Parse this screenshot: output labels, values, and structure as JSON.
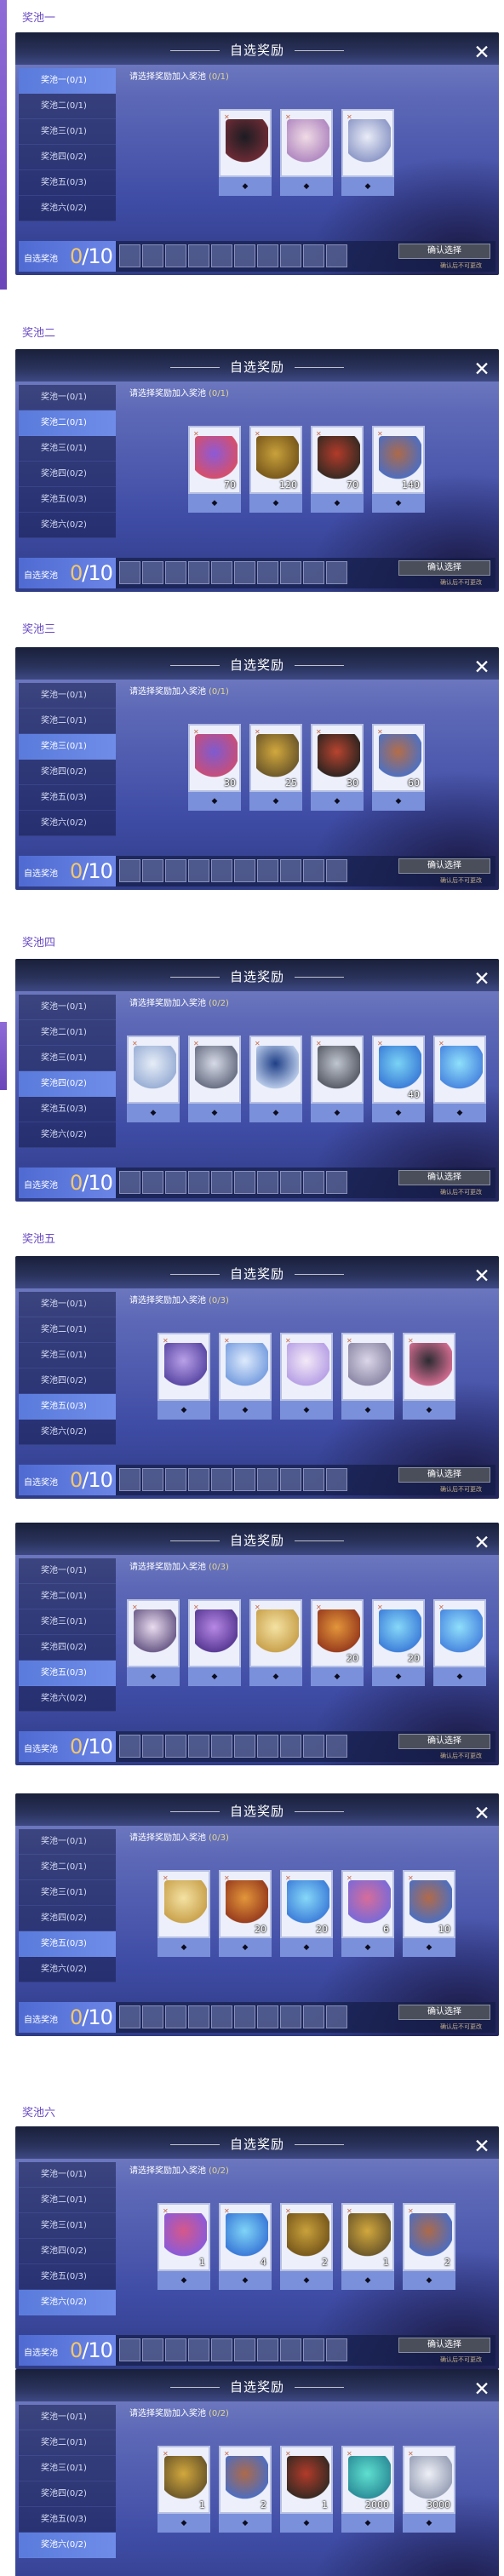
{
  "gutters": [
    1,
    2
  ],
  "screens": [
    {
      "section": "奖池一",
      "selected_tab": 0,
      "count": "0/1",
      "items": [
        {
          "icon": "armor-icon",
          "qty": "",
          "colors": [
            "#1c1c22",
            "#6b2b35"
          ]
        },
        {
          "icon": "dress-icon",
          "qty": "",
          "colors": [
            "#f0dbe5",
            "#b28ac1"
          ]
        },
        {
          "icon": "wing-weapon-icon",
          "qty": "",
          "colors": [
            "#e9ecf7",
            "#8f9ac8"
          ]
        }
      ]
    },
    {
      "section": "奖池二",
      "selected_tab": 1,
      "count": "0/1",
      "items": [
        {
          "icon": "gem-stone-icon",
          "qty": "70",
          "colors": [
            "#8c5ad7",
            "#d64f6b"
          ]
        },
        {
          "icon": "treasure-chest-icon",
          "qty": "120",
          "colors": [
            "#c9a13b",
            "#7a5a1c"
          ]
        },
        {
          "icon": "hammer-icon",
          "qty": "70",
          "colors": [
            "#b23b2a",
            "#3a2a22"
          ]
        },
        {
          "icon": "ore-icon",
          "qty": "140",
          "colors": [
            "#ad6a4a",
            "#4f6dbe"
          ]
        }
      ]
    },
    {
      "section": "奖池三",
      "selected_tab": 2,
      "count": "0/1",
      "items": [
        {
          "icon": "gem-stone-icon",
          "qty": "30",
          "colors": [
            "#7e5bd0",
            "#c74e7a"
          ]
        },
        {
          "icon": "crown-icon",
          "qty": "25",
          "colors": [
            "#d2a83d",
            "#6f5a2a"
          ]
        },
        {
          "icon": "hammer-icon",
          "qty": "30",
          "colors": [
            "#b8442f",
            "#322520"
          ]
        },
        {
          "icon": "ore-icon",
          "qty": "60",
          "colors": [
            "#b46d49",
            "#5070bf"
          ]
        }
      ]
    },
    {
      "section": "奖池四",
      "selected_tab": 3,
      "count": "0/2",
      "items": [
        {
          "icon": "gown-icon",
          "qty": "",
          "colors": [
            "#e6edf7",
            "#9bb0d6"
          ]
        },
        {
          "icon": "trident-icon",
          "qty": "",
          "colors": [
            "#d7dbe8",
            "#6b7185"
          ]
        },
        {
          "icon": "armor-icon",
          "qty": "",
          "colors": [
            "#1f3f87",
            "#b7c9e8"
          ]
        },
        {
          "icon": "scissors-icon",
          "qty": "",
          "colors": [
            "#c0c6d0",
            "#5a5e68"
          ]
        },
        {
          "icon": "crystal-icon",
          "qty": "40",
          "colors": [
            "#7ad3f5",
            "#3d7fd8"
          ]
        },
        {
          "icon": "crystal-icon",
          "qty": "",
          "colors": [
            "#8fe0fb",
            "#4a88e0"
          ]
        }
      ]
    },
    {
      "section": "奖池五",
      "selected_tab": 4,
      "count": "0/3",
      "items": [
        {
          "icon": "hairpin-icon",
          "qty": "",
          "colors": [
            "#b9a0e8",
            "#5c4aa6"
          ]
        },
        {
          "icon": "headband-icon",
          "qty": "",
          "colors": [
            "#ddeafc",
            "#7aa0e0"
          ]
        },
        {
          "icon": "butterfly-wing-icon",
          "qty": "",
          "colors": [
            "#f3e9f7",
            "#b9a2e6"
          ]
        },
        {
          "icon": "hair-icon",
          "qty": "",
          "colors": [
            "#dbd6e8",
            "#8e8aa8"
          ]
        },
        {
          "icon": "mask-icon",
          "qty": "",
          "colors": [
            "#2c2c33",
            "#cf6b8e"
          ]
        }
      ]
    },
    {
      "section": "",
      "selected_tab": 4,
      "count": "0/3",
      "items": [
        {
          "icon": "necklace-icon",
          "qty": "",
          "colors": [
            "#e9dcef",
            "#6d5d8a"
          ]
        },
        {
          "icon": "horns-icon",
          "qty": "",
          "colors": [
            "#b888e6",
            "#5a3b96"
          ]
        },
        {
          "icon": "lantern-icon",
          "qty": "",
          "colors": [
            "#f4e2a3",
            "#caa34e"
          ]
        },
        {
          "icon": "flame-icon",
          "qty": "20",
          "colors": [
            "#e3963a",
            "#9a3e1e"
          ]
        },
        {
          "icon": "crystal-icon",
          "qty": "20",
          "colors": [
            "#86d8f8",
            "#3f80da"
          ]
        },
        {
          "icon": "crystal-icon",
          "qty": "",
          "colors": [
            "#8fdffb",
            "#4a88e0"
          ]
        }
      ]
    },
    {
      "section": "",
      "selected_tab": 4,
      "count": "0/3",
      "items": [
        {
          "icon": "lantern-icon",
          "qty": "",
          "colors": [
            "#f4e2a3",
            "#caa34e"
          ]
        },
        {
          "icon": "flame-icon",
          "qty": "20",
          "colors": [
            "#e3963a",
            "#9a3e1e"
          ]
        },
        {
          "icon": "crystal-icon",
          "qty": "20",
          "colors": [
            "#86d8f8",
            "#3f80da"
          ]
        },
        {
          "icon": "gem-stone-icon",
          "qty": "6",
          "colors": [
            "#d76c9a",
            "#7c6ad6"
          ]
        },
        {
          "icon": "ore-icon",
          "qty": "10",
          "colors": [
            "#b26a4a",
            "#4e6fbe"
          ]
        }
      ]
    },
    {
      "section": "奖池六",
      "selected_tab": 5,
      "count": "0/2",
      "items": [
        {
          "icon": "gem-stone-icon",
          "qty": "1",
          "colors": [
            "#d6578a",
            "#8c5ad7"
          ]
        },
        {
          "icon": "crystal-icon",
          "qty": "4",
          "colors": [
            "#7fd4f7",
            "#3b7bd8"
          ]
        },
        {
          "icon": "treasure-chest-icon",
          "qty": "2",
          "colors": [
            "#c9a13b",
            "#7a5a1c"
          ]
        },
        {
          "icon": "crown-icon",
          "qty": "1",
          "colors": [
            "#d2a83d",
            "#6f5a2a"
          ]
        },
        {
          "icon": "ore-icon",
          "qty": "2",
          "colors": [
            "#ad6a4a",
            "#4f6dbe"
          ]
        }
      ]
    },
    {
      "section": "",
      "selected_tab": 5,
      "count": "0/2",
      "items": [
        {
          "icon": "crown-icon",
          "qty": "1",
          "colors": [
            "#d2a83d",
            "#6f5a2a"
          ]
        },
        {
          "icon": "ore-icon",
          "qty": "2",
          "colors": [
            "#ad6a4a",
            "#4f6dbe"
          ]
        },
        {
          "icon": "hammer-icon",
          "qty": "1",
          "colors": [
            "#b23b2a",
            "#3a2a22"
          ]
        },
        {
          "icon": "feather-icon",
          "qty": "2000",
          "colors": [
            "#5fe0d0",
            "#2d8f9a"
          ]
        },
        {
          "icon": "coin-icon",
          "qty": "3000",
          "colors": [
            "#eef0f6",
            "#9aa2b8"
          ]
        }
      ]
    }
  ],
  "ui": {
    "title": "自选奖励",
    "tabs": [
      "奖池一(0/1)",
      "奖池二(0/1)",
      "奖池三(0/1)",
      "奖池四(0/2)",
      "奖池五(0/3)",
      "奖池六(0/2)"
    ],
    "prompt": "请选择奖励加入奖池",
    "diamond_label": "◆",
    "slot_label": "自选奖池",
    "selected_count": "0",
    "max_count": "/10",
    "confirm": "确认选择",
    "note": "确认后不可更改"
  }
}
